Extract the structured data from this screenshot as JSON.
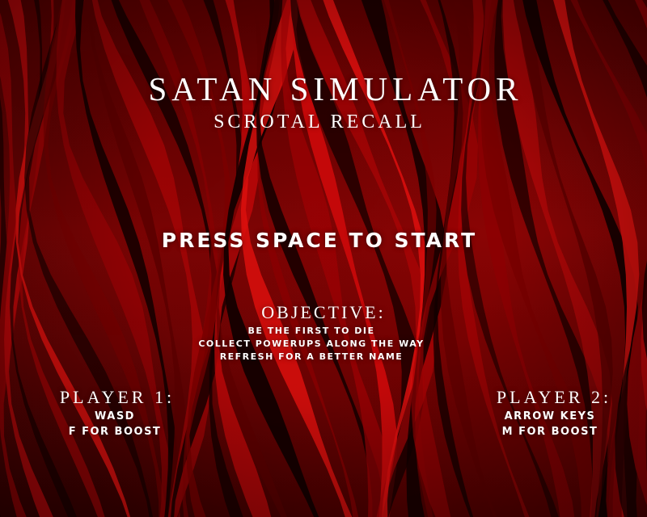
{
  "game": {
    "title": "SATAN SIMULATOR",
    "subtitle": "SCROTAL RECALL",
    "prompt": "PRESS SPACE TO START"
  },
  "objective": {
    "heading": "OBJECTIVE:",
    "lines": [
      "BE THE FIRST TO DIE",
      "COLLECT POWERUPS ALONG THE WAY",
      "REFRESH FOR A BETTER NAME"
    ]
  },
  "players": [
    {
      "heading": "PLAYER 1:",
      "controls": [
        "WASD",
        "F FOR BOOST"
      ]
    },
    {
      "heading": "PLAYER 2:",
      "controls": [
        "ARROW KEYS",
        "M FOR BOOST"
      ]
    }
  ],
  "colors": {
    "text": "#ffffff",
    "red_bright": "#c8080a",
    "red_dark": "#2a0000"
  }
}
